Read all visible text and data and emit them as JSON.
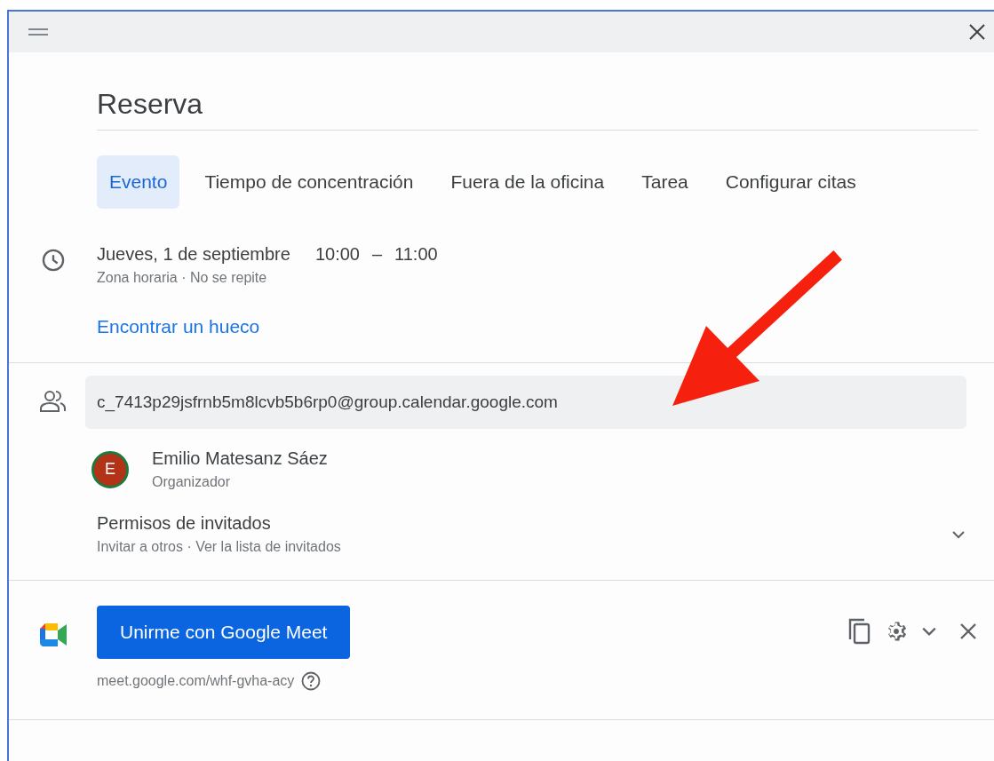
{
  "window": {
    "title": "Reserva"
  },
  "tabs": [
    {
      "label": "Evento",
      "selected": true
    },
    {
      "label": "Tiempo de concentración",
      "selected": false
    },
    {
      "label": "Fuera de la oficina",
      "selected": false
    },
    {
      "label": "Tarea",
      "selected": false
    },
    {
      "label": "Configurar citas",
      "selected": false
    }
  ],
  "date": {
    "day": "Jueves, 1 de septiembre",
    "start": "10:00",
    "separator": "–",
    "end": "11:00",
    "details": "Zona horaria · No se repite"
  },
  "find_time_link": "Encontrar un hueco",
  "guests": {
    "field_value": "c_7413p29jsfrnb5m8lcvb5b6rp0@group.calendar.google.com",
    "organizer": {
      "initial": "E",
      "name": "Emilio Matesanz Sáez",
      "role": "Organizador"
    },
    "permissions": {
      "title": "Permisos de invitados",
      "details": "Invitar a otros · Ver la lista de invitados",
      "expanded": false
    }
  },
  "meet": {
    "button": "Unirme con Google Meet",
    "link": "meet.google.com/whf-gvha-acy"
  }
}
